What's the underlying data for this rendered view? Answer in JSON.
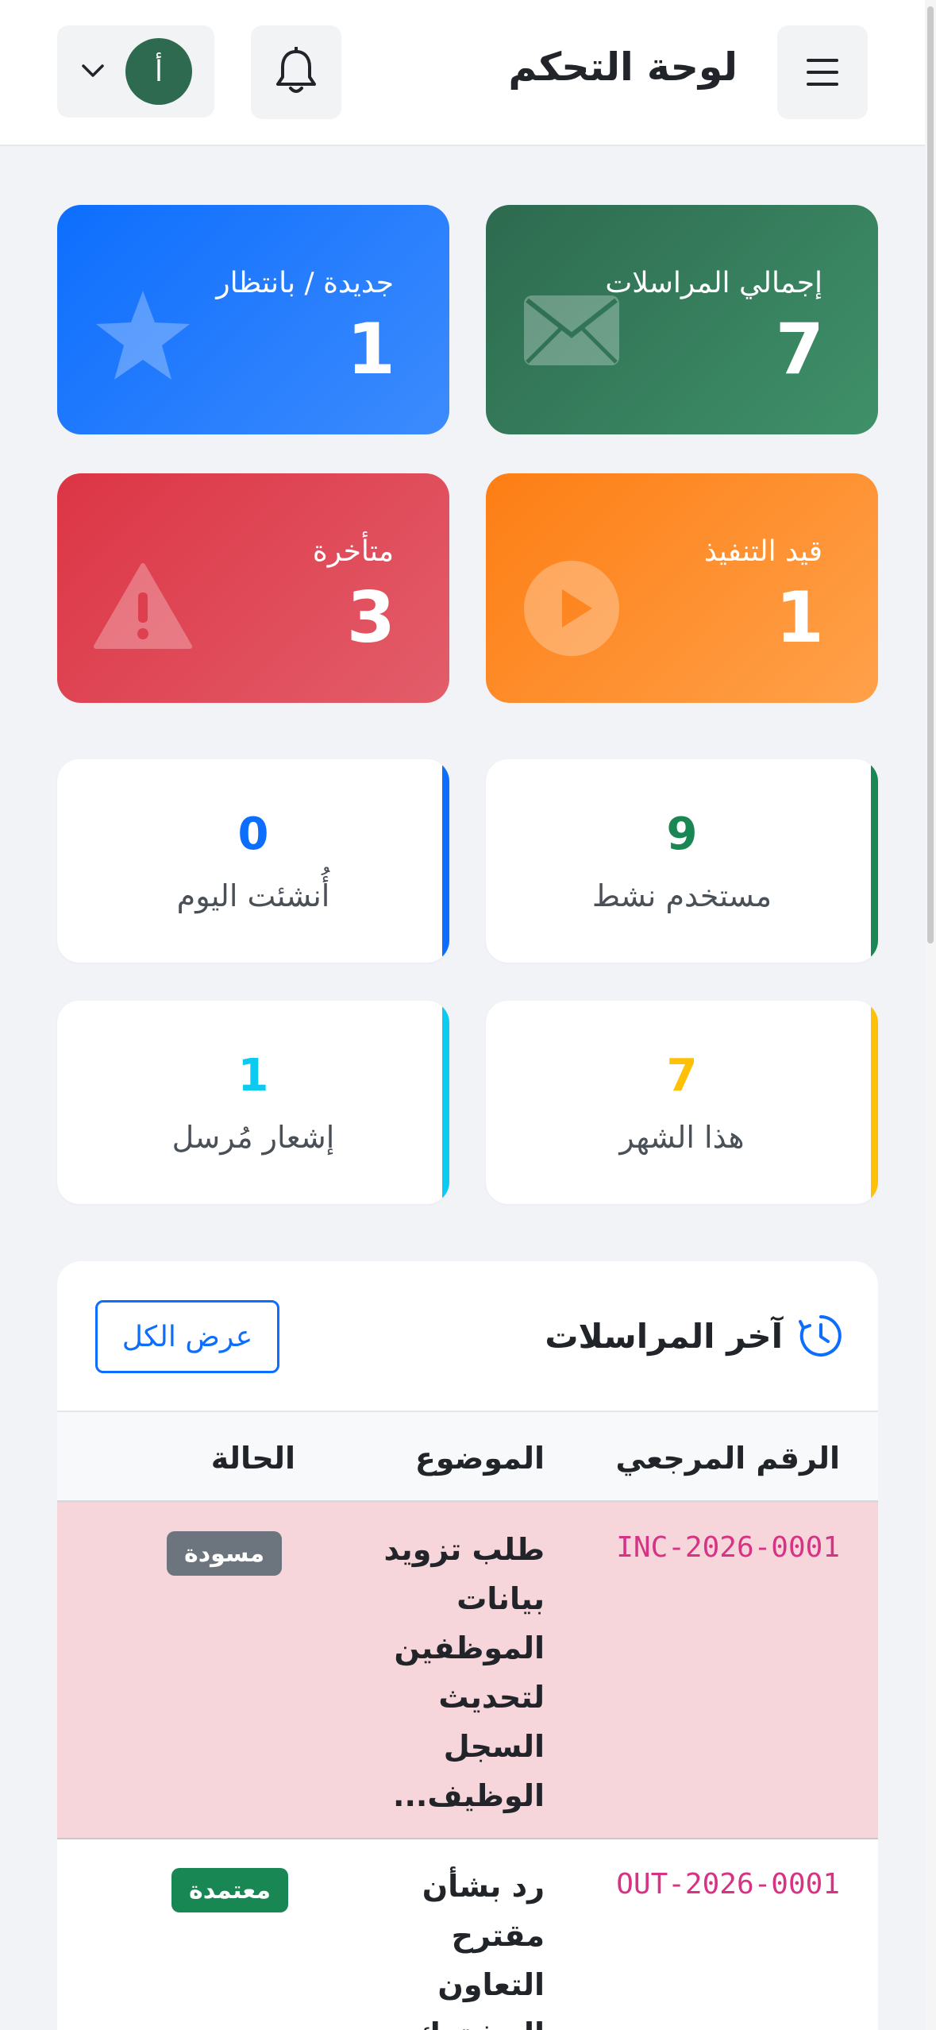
{
  "header": {
    "title": "لوحة التحكم",
    "avatar_initial": "أ",
    "avatar_color": "#2d6a4f"
  },
  "stats_primary": [
    {
      "label": "إجمالي المراسلات",
      "value": "7",
      "icon": "envelope-icon",
      "color": "#2d6a4f"
    },
    {
      "label": "جديدة / بانتظار",
      "value": "1",
      "icon": "star-icon",
      "color": "#0d6efd"
    },
    {
      "label": "قيد التنفيذ",
      "value": "1",
      "icon": "play-icon",
      "color": "#fd7e14"
    },
    {
      "label": "متأخرة",
      "value": "3",
      "icon": "warning-icon",
      "color": "#dc3545"
    }
  ],
  "stats_secondary": [
    {
      "label": "مستخدم نشط",
      "value": "9",
      "color": "#198754"
    },
    {
      "label": "أُنشئت اليوم",
      "value": "0",
      "color": "#0d6efd"
    },
    {
      "label": "هذا الشهر",
      "value": "7",
      "color": "#ffc107"
    },
    {
      "label": "إشعار مُرسل",
      "value": "1",
      "color": "#0dcaf0"
    }
  ],
  "latest": {
    "title": "آخر المراسلات",
    "view_all": "عرض الكل",
    "columns": [
      "الرقم المرجعي",
      "الموضوع",
      "الحالة"
    ],
    "rows": [
      {
        "ref": "INC-2026-0001",
        "subject": "طلب تزويد بيانات الموظفين لتحديث السجل الوظيف...",
        "status": "مسودة",
        "status_color": "#6c757d"
      },
      {
        "ref": "OUT-2026-0001",
        "subject": "رد بشأن مقترح التعاون المشترك",
        "status": "معتمدة",
        "status_color": "#198754"
      }
    ]
  }
}
